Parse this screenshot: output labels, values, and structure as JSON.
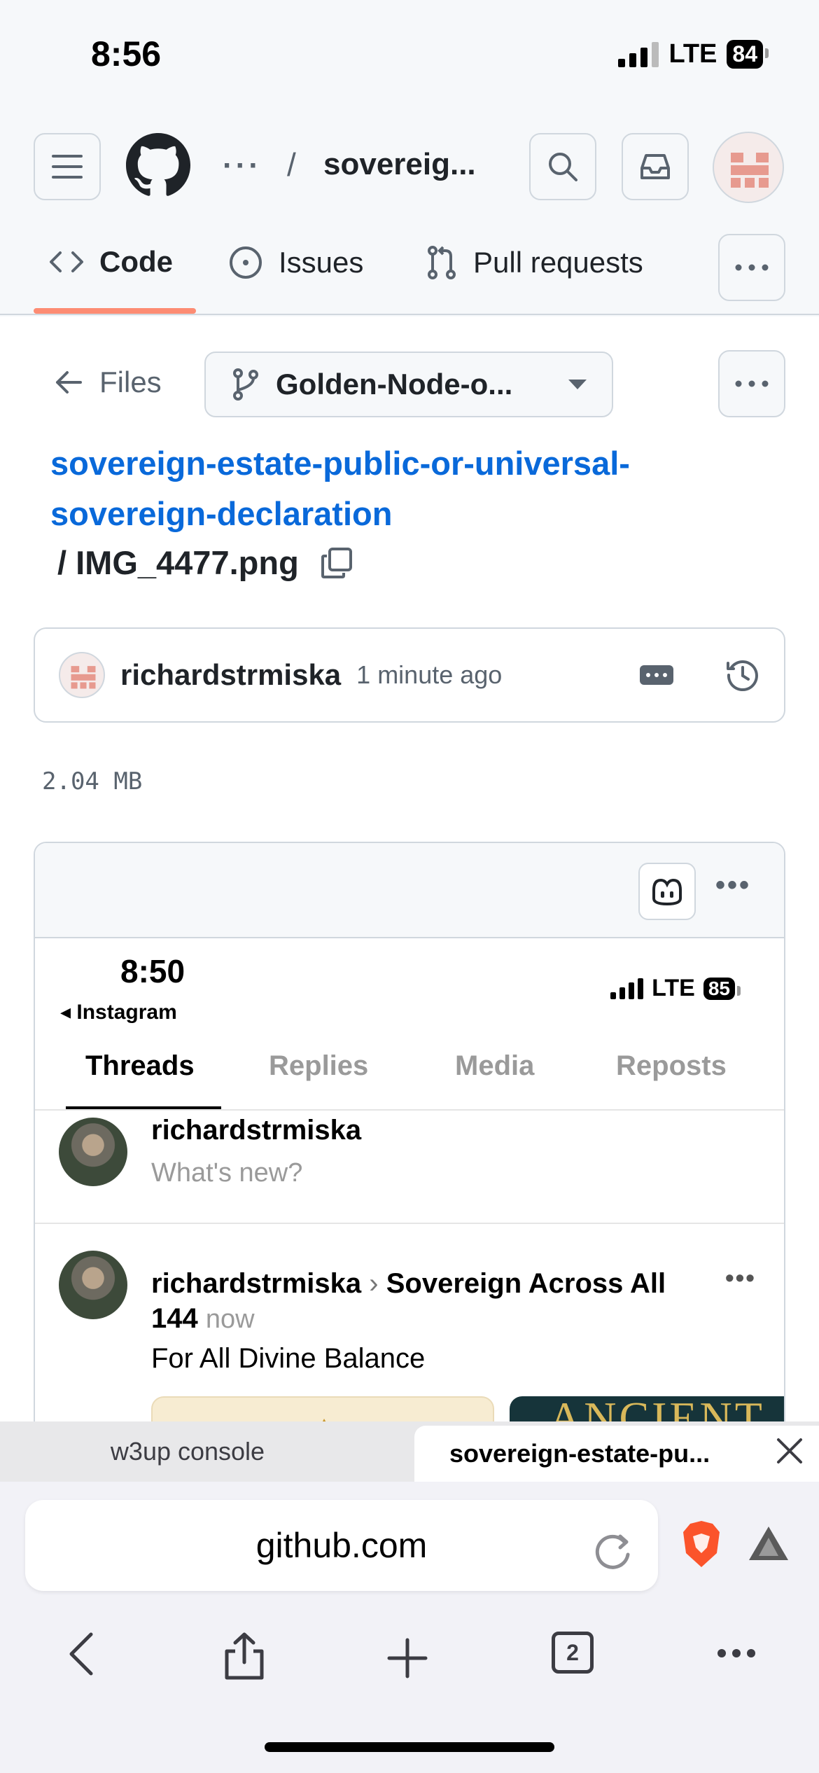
{
  "status_bar": {
    "time": "8:56",
    "network": "LTE",
    "battery": "84"
  },
  "header": {
    "repo_owner_overflow": "···",
    "separator": "/",
    "repo_name": "sovereig..."
  },
  "repo_tabs": {
    "code": "Code",
    "issues": "Issues",
    "pull_requests": "Pull requests"
  },
  "file_nav": {
    "back_label": "Files",
    "branch": "Golden-Node-o..."
  },
  "path": {
    "folder": "sovereign-estate-public-or-universal-sovereign-declaration",
    "separator": "/",
    "file": "IMG_4477.png"
  },
  "commit": {
    "author": "richardstrmiska",
    "time": "1 minute ago"
  },
  "file_size": "2.04 MB",
  "preview": {
    "status_time": "8:50",
    "back_app": "◂ Instagram",
    "network": "LTE",
    "battery": "85",
    "tabs": [
      "Threads",
      "Replies",
      "Media",
      "Reposts"
    ],
    "composer": {
      "user": "richardstrmiska",
      "placeholder": "What's new?"
    },
    "post": {
      "user": "richardstrmiska",
      "arrow": "›",
      "community": "Sovereign Across All 144",
      "time": "now",
      "body": "For All Divine Balance",
      "image2_text": "ANCIENT"
    }
  },
  "browser_tabs": {
    "tab1": "w3up console",
    "tab2": "sovereign-estate-pu..."
  },
  "address_bar": {
    "url": "github.com"
  },
  "toolbar": {
    "tab_count": "2"
  },
  "colors": {
    "link": "#0969da",
    "code_underline": "#fd8c73",
    "border": "#d0d7de",
    "muted": "#59636e",
    "brave": "#fb542b"
  }
}
